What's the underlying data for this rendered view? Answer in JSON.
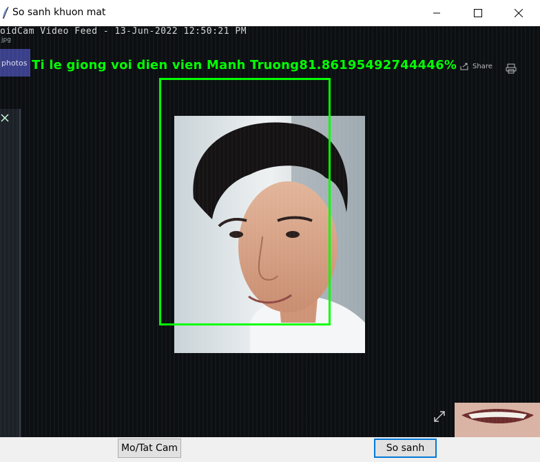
{
  "window": {
    "title": "So sanh khuon mat"
  },
  "feed": {
    "caption": "oidCam Video Feed - 13-Jun-2022 12:50:21 PM",
    "file_ext": "jpg",
    "photos_tab": "photos",
    "share_label": "Share",
    "similarity_text": "Ti le giong voi dien vien Manh Truong81.86195492744446%"
  },
  "buttons": {
    "toggle_cam": "Mo/Tat Cam",
    "compare": "So sanh"
  }
}
